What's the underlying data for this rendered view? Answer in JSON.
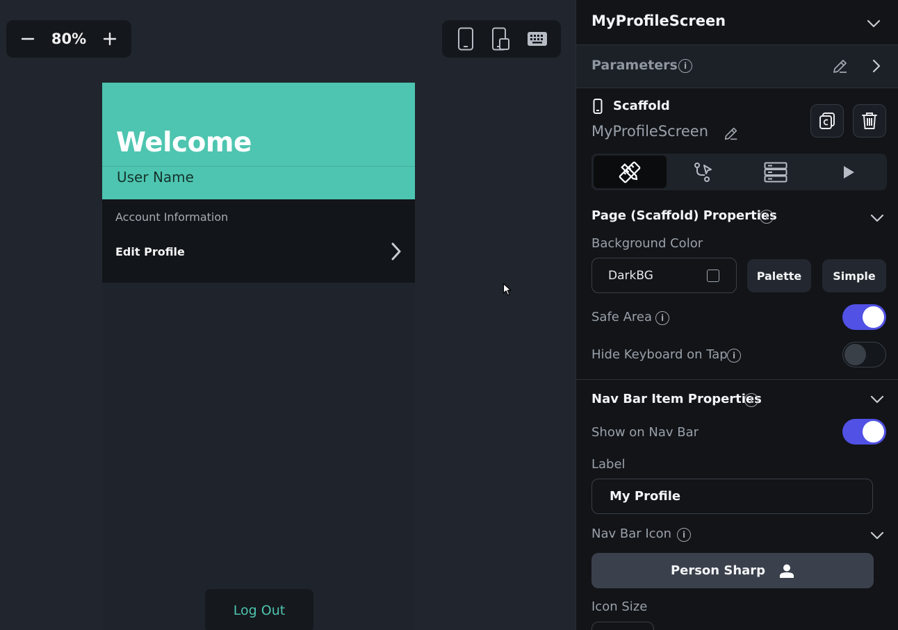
{
  "canvas": {
    "zoom": "80%",
    "zoom_out_icon": "minus-icon",
    "zoom_in_icon": "plus-icon",
    "device_icons": [
      "phone-icon",
      "tablet-icon",
      "keyboard-icon"
    ]
  },
  "preview": {
    "welcome": "Welcome",
    "user_name": "User Name",
    "section_title": "Account Information",
    "edit_profile": "Edit Profile",
    "logout": "Log Out",
    "colors": {
      "header": "#4ec5b0",
      "card": "#121519",
      "accent": "#4ec5b0"
    }
  },
  "panel": {
    "title": "MyProfileScreen",
    "parameters": "Parameters",
    "widget_type": "Scaffold",
    "widget_name": "MyProfileScreen",
    "tabs": [
      "properties-icon",
      "actions-icon",
      "backend-query-icon",
      "play-icon"
    ],
    "page_section": {
      "title": "Page (Scaffold) Properties",
      "bg_label": "Background Color",
      "bg_value": "DarkBG",
      "palette": "Palette",
      "simple": "Simple",
      "safe_area": "Safe Area",
      "safe_area_on": true,
      "hide_keyboard": "Hide Keyboard on Tap",
      "hide_keyboard_on": false
    },
    "nav_section": {
      "title": "Nav Bar Item Properties",
      "show_on_nav": "Show on Nav Bar",
      "show_on_nav_on": true,
      "label_caption": "Label",
      "label_value": "My Profile",
      "icon_caption": "Nav Bar Icon",
      "icon_value": "Person Sharp",
      "icon_size": "Icon Size"
    },
    "colors": {
      "toggle_on": "#5151e5",
      "panel_bg": "#121418"
    }
  }
}
